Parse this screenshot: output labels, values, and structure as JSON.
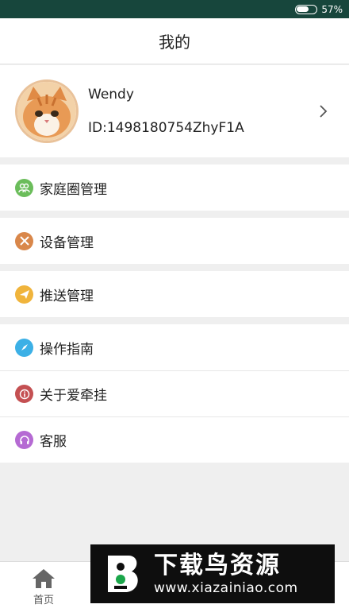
{
  "status_bar": {
    "battery_text": "57%",
    "battery_level": 0.57
  },
  "header": {
    "title": "我的"
  },
  "profile": {
    "name": "Wendy",
    "id_text": "ID:1498180754ZhyF1A"
  },
  "menu": {
    "family_circle": "家庭圈管理",
    "device": "设备管理",
    "push": "推送管理",
    "guide": "操作指南",
    "about": "关于爱牵挂",
    "service": "客服"
  },
  "nav": {
    "home": "首页"
  },
  "watermark": {
    "title": "下载鸟资源",
    "url": "www.xiazainiao.com"
  },
  "colors": {
    "status_bar": "#17463c",
    "icon_green": "#6bbd5b",
    "icon_orange": "#d9874a",
    "icon_yellow": "#f0b43c",
    "icon_blue": "#3cb0e6",
    "icon_red": "#c45052",
    "icon_purple": "#b56ad3"
  }
}
